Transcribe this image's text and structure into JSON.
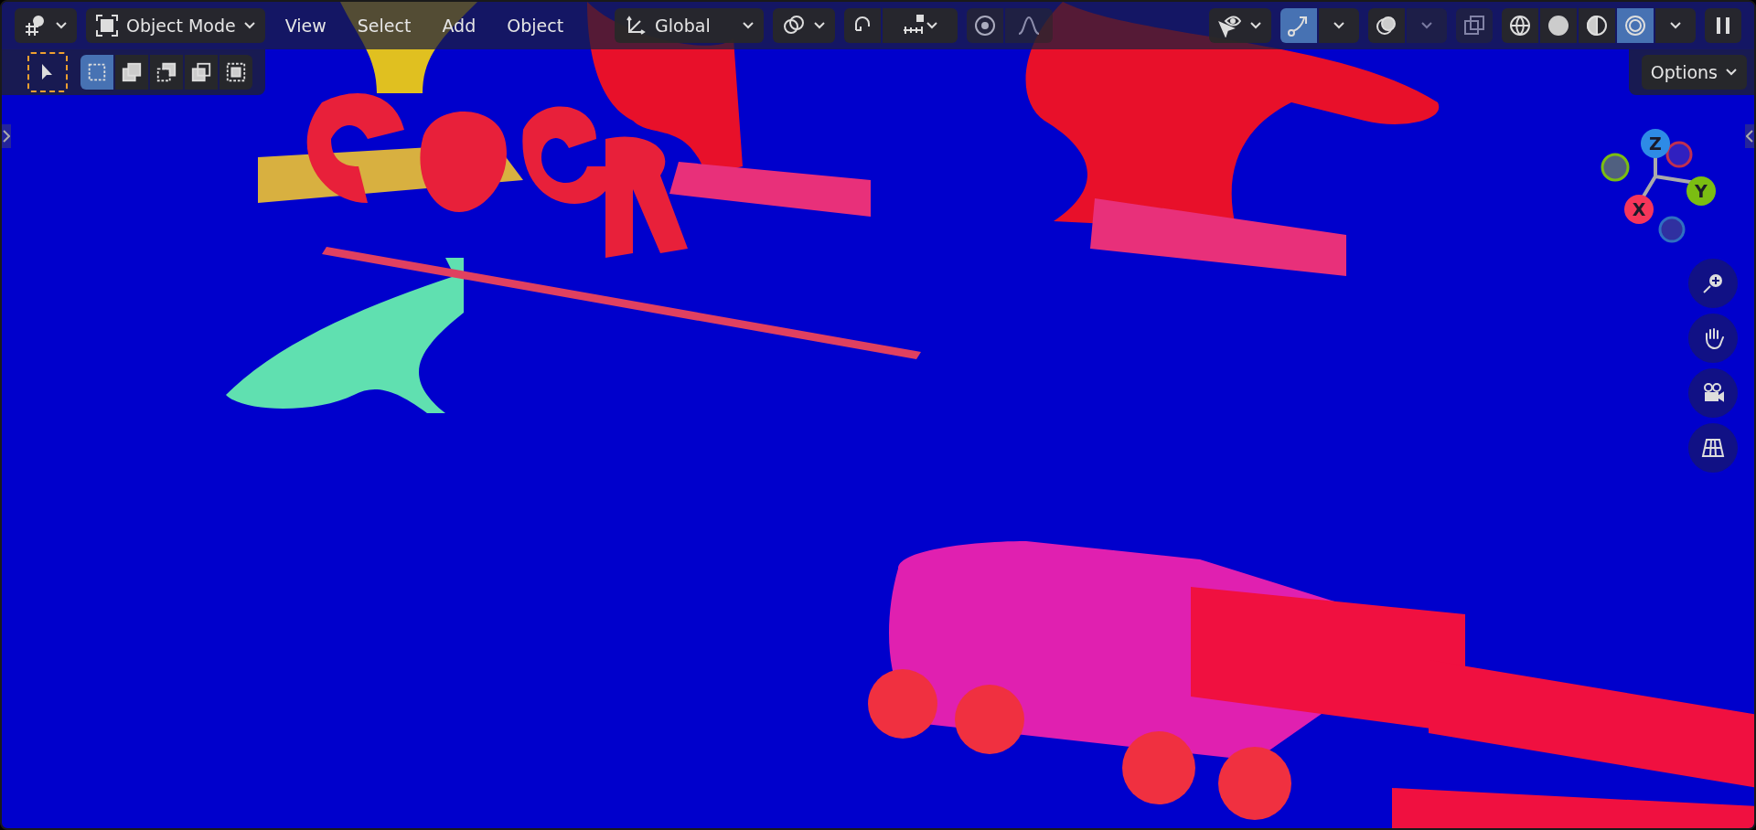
{
  "header": {
    "mode": {
      "label": "Object Mode"
    },
    "menus": [
      {
        "label": "View"
      },
      {
        "label": "Select"
      },
      {
        "label": "Add"
      },
      {
        "label": "Object"
      }
    ],
    "orientation": {
      "label": "Global"
    },
    "snap": {
      "on": false
    },
    "proportional": {
      "on": false
    },
    "gizmos": {
      "on": true
    },
    "overlays": {
      "on": false
    },
    "xray": {
      "on": false
    },
    "shading": [
      {
        "kind": "wireframe",
        "selected": false
      },
      {
        "kind": "solid",
        "selected": false
      },
      {
        "kind": "material",
        "selected": false
      },
      {
        "kind": "rendered",
        "selected": true
      }
    ]
  },
  "select_tool": {
    "selected": true
  },
  "select_modes": [
    {
      "kind": "new",
      "selected": true
    },
    {
      "kind": "extend",
      "selected": false
    },
    {
      "kind": "subtract",
      "selected": false
    },
    {
      "kind": "invert",
      "selected": false
    },
    {
      "kind": "intersect",
      "selected": false
    }
  ],
  "options": {
    "label": "Options"
  },
  "navigation_gizmo": {
    "axes": [
      {
        "label": "Z",
        "color": "#2e8be6"
      },
      {
        "label": "Y",
        "color": "#7bbd12"
      },
      {
        "label": "X",
        "color": "#f5365a"
      }
    ]
  }
}
